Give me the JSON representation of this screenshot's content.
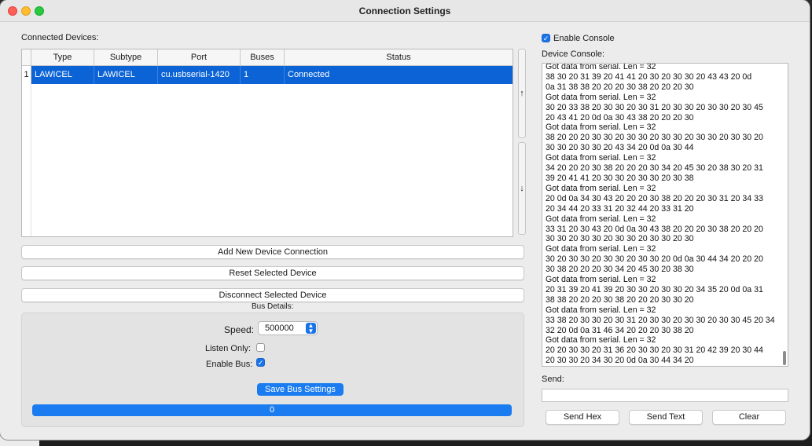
{
  "window": {
    "title": "Connection Settings"
  },
  "devices": {
    "section_label": "Connected Devices:",
    "columns": [
      "Type",
      "Subtype",
      "Port",
      "Buses",
      "Status"
    ],
    "rows": [
      {
        "num": "1",
        "type": "LAWICEL",
        "subtype": "LAWICEL",
        "port": "cu.usbserial-1420",
        "buses": "1",
        "status": "Connected"
      }
    ],
    "move_up_label": "↑",
    "move_down_label": "↓"
  },
  "actions": {
    "add_label": "Add New Device Connection",
    "reset_label": "Reset Selected Device",
    "disconnect_label": "Disconnect Selected Device"
  },
  "bus": {
    "section_label": "Bus Details:",
    "speed_label": "Speed:",
    "speed_value": "500000",
    "listen_only_label": "Listen Only:",
    "listen_only_checked": false,
    "enable_bus_label": "Enable Bus:",
    "enable_bus_checked": true,
    "save_label": "Save Bus Settings",
    "progress_value": "0",
    "progress_fraction": 1.0
  },
  "console": {
    "enable_label": "Enable Console",
    "enable_checked": true,
    "label": "Device Console:",
    "text": "Got data from serial. Len = 32\n38 30 20 31 39 20 41 41 20 30 20 30 30 20 43 43 20 0d\n0a 31 38 38 20 20 20 30 38 20 20 20 30\nGot data from serial. Len = 32\n30 20 33 38 20 30 30 20 30 31 20 30 30 20 30 30 20 30 45\n20 43 41 20 0d 0a 30 43 38 20 20 20 30\nGot data from serial. Len = 32\n38 20 20 20 30 30 20 30 30 20 30 30 20 30 30 20 30 30 20\n30 30 20 30 30 20 43 34 20 0d 0a 30 44\nGot data from serial. Len = 32\n34 20 20 20 30 38 20 20 20 30 34 20 45 30 20 38 30 20 31\n39 20 41 41 20 30 30 20 30 30 20 30 38\nGot data from serial. Len = 32\n20 0d 0a 34 30 43 20 20 20 30 38 20 20 20 30 31 20 34 33\n20 34 44 20 33 31 20 32 44 20 33 31 20\nGot data from serial. Len = 32\n33 31 20 30 43 20 0d 0a 30 43 38 20 20 20 30 38 20 20 20\n30 30 20 30 30 20 30 30 20 30 30 20 30\nGot data from serial. Len = 32\n30 20 30 30 20 30 30 20 30 30 20 0d 0a 30 44 34 20 20 20\n30 38 20 20 20 30 34 20 45 30 20 38 30\nGot data from serial. Len = 32\n20 31 39 20 41 39 20 30 30 20 30 30 20 34 35 20 0d 0a 31\n38 38 20 20 20 30 38 20 20 20 30 30 20\nGot data from serial. Len = 32\n33 38 20 30 30 20 30 31 20 30 30 20 30 30 20 30 30 45 20 34\n32 20 0d 0a 31 46 34 20 20 20 30 38 20\nGot data from serial. Len = 32\n20 20 30 30 20 31 36 20 30 30 20 30 31 20 42 39 20 30 44\n20 30 30 20 34 30 20 0d 0a 30 44 34 20"
  },
  "send": {
    "label": "Send:",
    "value": "",
    "hex_label": "Send Hex",
    "text_label": "Send Text",
    "clear_label": "Clear"
  },
  "colors": {
    "accent": "#1a7cf0",
    "selection": "#0b63d6"
  }
}
